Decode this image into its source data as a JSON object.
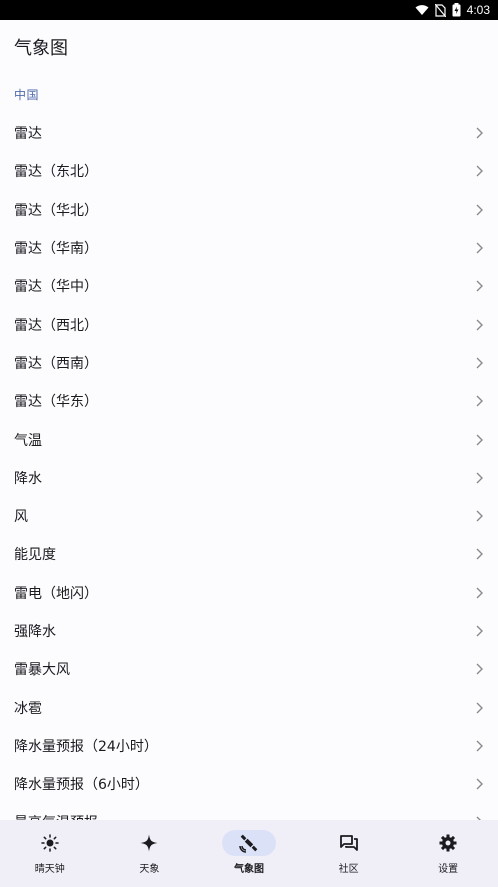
{
  "status_bar": {
    "time": "4:03"
  },
  "app_bar": {
    "title": "气象图"
  },
  "section": {
    "title": "中国"
  },
  "items": [
    {
      "label": "雷达"
    },
    {
      "label": "雷达（东北）"
    },
    {
      "label": "雷达（华北）"
    },
    {
      "label": "雷达（华南）"
    },
    {
      "label": "雷达（华中）"
    },
    {
      "label": "雷达（西北）"
    },
    {
      "label": "雷达（西南）"
    },
    {
      "label": "雷达（华东）"
    },
    {
      "label": "气温"
    },
    {
      "label": "降水"
    },
    {
      "label": "风"
    },
    {
      "label": "能见度"
    },
    {
      "label": "雷电（地闪）"
    },
    {
      "label": "强降水"
    },
    {
      "label": "雷暴大风"
    },
    {
      "label": "冰雹"
    },
    {
      "label": "降水量预报（24小时）"
    },
    {
      "label": "降水量预报（6小时）"
    },
    {
      "label": "最高气温预报"
    }
  ],
  "nav": [
    {
      "label": "晴天钟",
      "icon": "sun-icon",
      "active": false
    },
    {
      "label": "天象",
      "icon": "sparkle-icon",
      "active": false
    },
    {
      "label": "气象图",
      "icon": "satellite-icon",
      "active": true
    },
    {
      "label": "社区",
      "icon": "forum-icon",
      "active": false
    },
    {
      "label": "设置",
      "icon": "gear-icon",
      "active": false
    }
  ],
  "colors": {
    "accent": "#4f6bad",
    "nav_background": "#f0eef7",
    "nav_active_pill": "#dbe2f8",
    "background": "#fcfbfe"
  }
}
